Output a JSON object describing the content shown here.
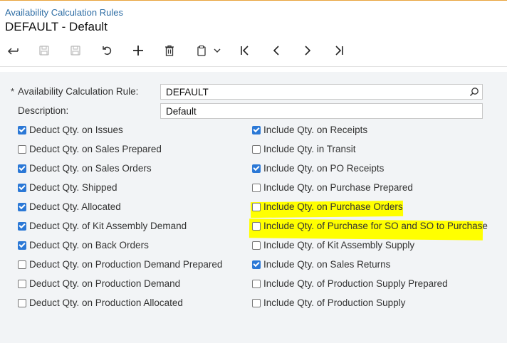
{
  "header": {
    "breadcrumb": "Availability Calculation Rules",
    "title": "DEFAULT - Default"
  },
  "toolbar": {
    "icons": [
      "back-icon",
      "save-close-icon",
      "save-icon",
      "undo-icon",
      "add-icon",
      "delete-icon",
      "copy-paste-icon",
      "first-icon",
      "prev-icon",
      "next-icon",
      "last-icon"
    ]
  },
  "form": {
    "rule_label": "Availability Calculation Rule:",
    "rule_value": "DEFAULT",
    "description_label": "Description:",
    "description_value": "Default",
    "left": [
      {
        "label": "Deduct Qty. on Issues",
        "checked": true
      },
      {
        "label": "Deduct Qty. on Sales Prepared",
        "checked": false
      },
      {
        "label": "Deduct Qty. on Sales Orders",
        "checked": true
      },
      {
        "label": "Deduct Qty. Shipped",
        "checked": true
      },
      {
        "label": "Deduct Qty. Allocated",
        "checked": true
      },
      {
        "label": "Deduct Qty. of Kit Assembly Demand",
        "checked": true
      },
      {
        "label": "Deduct Qty. on Back Orders",
        "checked": true
      },
      {
        "label": "Deduct Qty. on Production Demand Prepared",
        "checked": false
      },
      {
        "label": "Deduct Qty. on Production Demand",
        "checked": false
      },
      {
        "label": "Deduct Qty. on Production Allocated",
        "checked": false
      }
    ],
    "right": [
      {
        "label": "Include Qty. on Receipts",
        "checked": true
      },
      {
        "label": "Include Qty. in Transit",
        "checked": false
      },
      {
        "label": "Include Qty. on PO Receipts",
        "checked": true
      },
      {
        "label": "Include Qty. on Purchase Prepared",
        "checked": false
      },
      {
        "label": "Include Qty. on Purchase Orders",
        "checked": false
      },
      {
        "label": "Include Qty. of Purchase for SO and SO to Purchase",
        "checked": false
      },
      {
        "label": "Include Qty. of Kit Assembly Supply",
        "checked": false
      },
      {
        "label": "Include Qty. on Sales Returns",
        "checked": true
      },
      {
        "label": "Include Qty. of Production Supply Prepared",
        "checked": false
      },
      {
        "label": "Include Qty. of Production Supply",
        "checked": false
      }
    ]
  },
  "colors": {
    "accent": "#2b78d6",
    "highlight": "#ffff00",
    "breadcrumb": "#2f6ea5"
  }
}
